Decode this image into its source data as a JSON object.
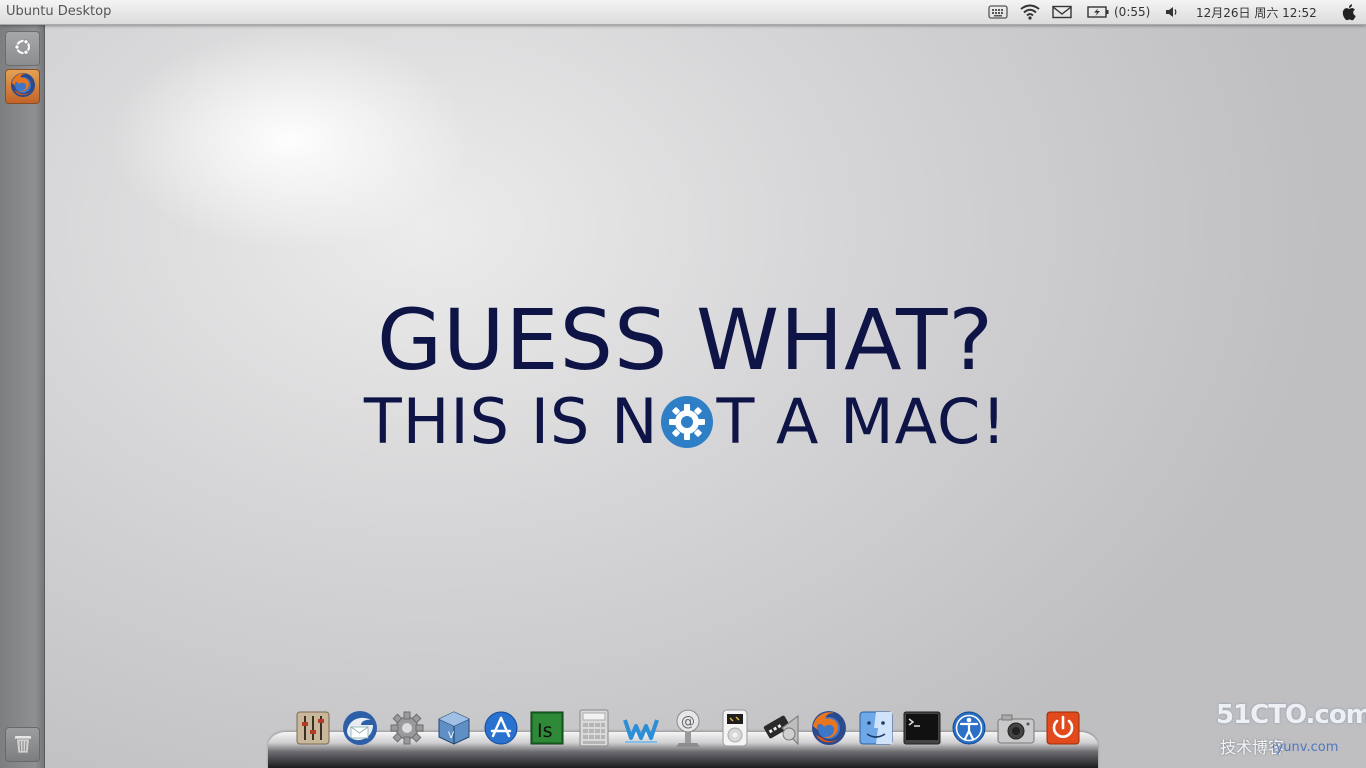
{
  "panel": {
    "window_title": "Ubuntu Desktop",
    "battery_time": "(0:55)",
    "clock": "12月26日 周六 12:52",
    "indicators": [
      "keyboard-icon",
      "wifi-icon",
      "mail-icon",
      "battery-icon",
      "volume-icon",
      "apple-icon"
    ]
  },
  "launcher": {
    "items": [
      {
        "name": "dash-home",
        "icon": "ubuntu-logo-icon"
      },
      {
        "name": "firefox",
        "icon": "firefox-icon"
      },
      {
        "name": "trash",
        "icon": "trash-icon"
      }
    ]
  },
  "desktop": {
    "headline_line1": "GUESS WHAT?",
    "headline_line2_before": "THIS IS N",
    "headline_line2_after": "T A MAC!",
    "text_color": "#0f1447",
    "gear_color": "#2f7fc6"
  },
  "dock": {
    "items": [
      {
        "icon": "mixer-icon"
      },
      {
        "icon": "thunderbird-icon"
      },
      {
        "icon": "settings-gear-icon"
      },
      {
        "icon": "virtualbox-icon"
      },
      {
        "icon": "app-store-icon"
      },
      {
        "icon": "indesign-icon"
      },
      {
        "icon": "calculator-icon"
      },
      {
        "icon": "wunderlist-icon"
      },
      {
        "icon": "at-mail-icon"
      },
      {
        "icon": "ipod-icon"
      },
      {
        "icon": "video-editor-icon"
      },
      {
        "icon": "firefox-icon"
      },
      {
        "icon": "finder-icon"
      },
      {
        "icon": "terminal-icon"
      },
      {
        "icon": "accessibility-icon"
      },
      {
        "icon": "camera-icon"
      },
      {
        "icon": "power-icon"
      }
    ]
  },
  "watermark": {
    "main": "51CTO.com",
    "sub": "技术博客",
    "url": "iyunv.com"
  }
}
